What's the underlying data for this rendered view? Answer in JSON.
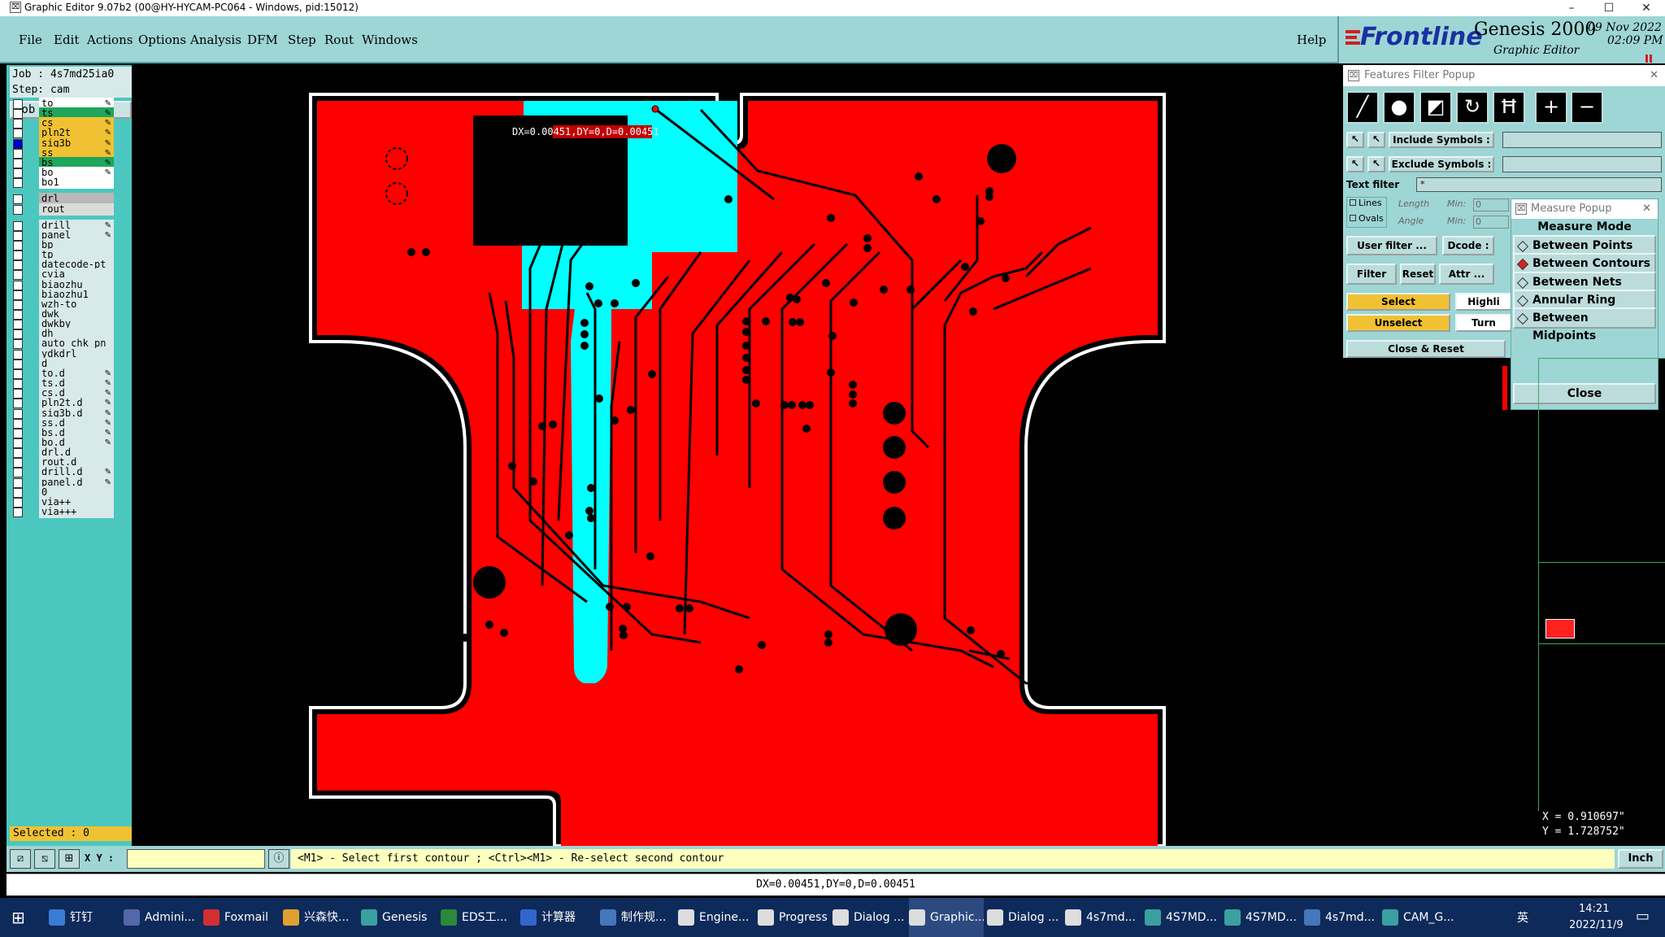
{
  "window": {
    "title": "Graphic Editor 9.07b2 (00@HY-HYCAM-PC064 - Windows, pid:15012)"
  },
  "menu": {
    "items": [
      "File",
      "Edit",
      "Actions",
      "Options",
      "Analysis",
      "DFM",
      "Step",
      "Rout",
      "Windows"
    ],
    "help": "Help"
  },
  "brand": {
    "logo": "Frontline",
    "product": "Genesis 2000",
    "subtitle": "Graphic Editor",
    "date": "09 Nov 2022",
    "time": "02:09 PM"
  },
  "job": {
    "line1": "Job : 4s7md25ia0",
    "line2": "Step: cam",
    "matrix_button": "Job Matrix ..."
  },
  "layers": [
    {
      "name": "to",
      "color": "#ffffff",
      "edit": true
    },
    {
      "name": "ts",
      "color": "#1fa65a",
      "edit": true
    },
    {
      "name": "cs",
      "color": "#f0c233",
      "edit": true
    },
    {
      "name": "pln2t",
      "color": "#f0c233",
      "edit": true
    },
    {
      "name": "sig3b",
      "color": "#f0c233",
      "edit": true,
      "active": true
    },
    {
      "name": "ss",
      "color": "#f0c233",
      "edit": true
    },
    {
      "name": "bs",
      "color": "#1fa65a",
      "edit": true
    },
    {
      "name": "bo",
      "color": "#ffffff",
      "edit": true
    },
    {
      "name": "bo1",
      "color": "#ffffff",
      "edit": false
    },
    {
      "name": "drl",
      "color": "#b8b8b8",
      "edit": false,
      "gap": true
    },
    {
      "name": "rout",
      "color": "#dcdcdc",
      "edit": false
    },
    {
      "name": "drill",
      "color": "#d8e9e9",
      "edit": true,
      "gap": true
    },
    {
      "name": "panel",
      "color": "#d8e9e9",
      "edit": true
    },
    {
      "name": "bp",
      "color": "#d8e9e9",
      "edit": false
    },
    {
      "name": "tp",
      "color": "#d8e9e9",
      "edit": false
    },
    {
      "name": "datecode-pt",
      "color": "#d8e9e9",
      "edit": false
    },
    {
      "name": "cvia",
      "color": "#d8e9e9",
      "edit": false
    },
    {
      "name": "biaozhu",
      "color": "#d8e9e9",
      "edit": false
    },
    {
      "name": "biaozhu1",
      "color": "#d8e9e9",
      "edit": false
    },
    {
      "name": "wzh-to",
      "color": "#d8e9e9",
      "edit": false
    },
    {
      "name": "dwk",
      "color": "#d8e9e9",
      "edit": false
    },
    {
      "name": "dwkby",
      "color": "#d8e9e9",
      "edit": false
    },
    {
      "name": "dh",
      "color": "#d8e9e9",
      "edit": false
    },
    {
      "name": "auto_chk_pn",
      "color": "#d8e9e9",
      "edit": false
    },
    {
      "name": "ydkdrl",
      "color": "#d8e9e9",
      "edit": false
    },
    {
      "name": "d",
      "color": "#d8e9e9",
      "edit": false
    },
    {
      "name": "to.d",
      "color": "#d8e9e9",
      "edit": true
    },
    {
      "name": "ts.d",
      "color": "#d8e9e9",
      "edit": true
    },
    {
      "name": "cs.d",
      "color": "#d8e9e9",
      "edit": true
    },
    {
      "name": "pln2t.d",
      "color": "#d8e9e9",
      "edit": true
    },
    {
      "name": "sig3b.d",
      "color": "#d8e9e9",
      "edit": true
    },
    {
      "name": "ss.d",
      "color": "#d8e9e9",
      "edit": true
    },
    {
      "name": "bs.d",
      "color": "#d8e9e9",
      "edit": true
    },
    {
      "name": "bo.d",
      "color": "#d8e9e9",
      "edit": true
    },
    {
      "name": "drl.d",
      "color": "#d8e9e9",
      "edit": false
    },
    {
      "name": "rout.d",
      "color": "#d8e9e9",
      "edit": false
    },
    {
      "name": "drill.d",
      "color": "#d8e9e9",
      "edit": true
    },
    {
      "name": "panel.d",
      "color": "#d8e9e9",
      "edit": true
    },
    {
      "name": "0",
      "color": "#d8e9e9",
      "edit": false
    },
    {
      "name": "via++",
      "color": "#d8e9e9",
      "edit": false
    },
    {
      "name": "via+++",
      "color": "#d8e9e9",
      "edit": false
    }
  ],
  "selected": "Selected : 0",
  "canvas": {
    "measure_label": "DX=0.00451,DY=0,D=0.00451"
  },
  "features_filter": {
    "title": "Features Filter Popup",
    "include_label": "Include Symbols :",
    "exclude_label": "Exclude Symbols :",
    "text_filter_label": "Text filter",
    "text_filter_value": "*",
    "lines": "Lines",
    "ovals": "Ovals",
    "length": "Length",
    "angle": "Angle",
    "min": "Min:",
    "min_value": "0",
    "user_filter": "User filter ...",
    "dcode": "Dcode :",
    "filter": "Filter",
    "reset": "Reset",
    "attr": "Attr ...",
    "select": "Select",
    "highlight": "Highli",
    "unselect": "Unselect",
    "turn": "Turn",
    "close_reset": "Close & Reset"
  },
  "measure": {
    "title": "Measure Popup",
    "mode_label": "Measure Mode",
    "options": [
      "Between Points",
      "Between Contours",
      "Between Nets",
      "Annular Ring",
      "Between Midpoints"
    ],
    "selected_index": 1,
    "close": "Close"
  },
  "coords": {
    "x": "X = 0.910697\"",
    "y": "Y = 1.728752\""
  },
  "command": {
    "xy_label": "X Y :",
    "message": "<M1> - Select first contour ; <Ctrl><M1> - Re-select second contour",
    "units": "Inch"
  },
  "status": "DX=0.00451,DY=0,D=0.00451",
  "taskbar": {
    "items": [
      "钉钉",
      "Admini...",
      "Foxmail",
      "兴森快...",
      "Genesis",
      "EDS工...",
      "计算器",
      "制作规...",
      "Engine...",
      "Progress",
      "Dialog ...",
      "Graphic...",
      "Dialog ...",
      "4s7md...",
      "4S7MD...",
      "4S7MD...",
      "4s7md...",
      "CAM_G..."
    ],
    "time": "14:21",
    "date": "2022/11/9",
    "ime": "英"
  }
}
